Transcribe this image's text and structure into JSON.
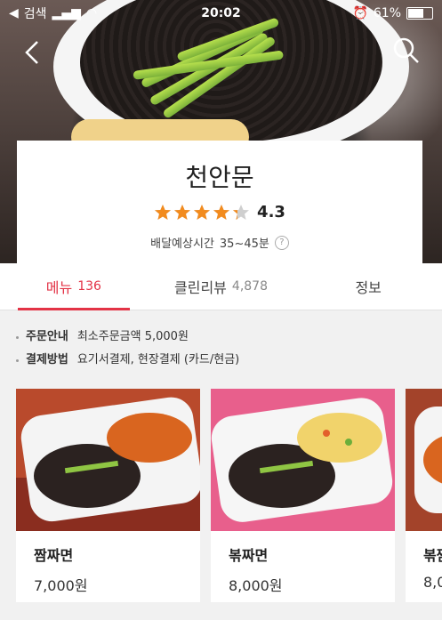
{
  "status_bar": {
    "back_app": "검색",
    "time": "20:02",
    "battery": "61%"
  },
  "header": {
    "icons": [
      "back-arrow-icon",
      "search-icon"
    ]
  },
  "restaurant": {
    "name": "천안문",
    "rating": "4.3",
    "stars": 4.3,
    "delivery_label": "배달예상시간",
    "delivery_time": "35~45분"
  },
  "tabs": [
    {
      "label": "메뉴",
      "count": "136",
      "active": true
    },
    {
      "label": "클린리뷰",
      "count": "4,878",
      "active": false
    },
    {
      "label": "정보",
      "count": "",
      "active": false
    }
  ],
  "info": [
    {
      "label": "주문안내",
      "value": "최소주문금액 5,000원"
    },
    {
      "label": "결제방법",
      "value": "요기서결제, 현장결제 (카드/현금)"
    }
  ],
  "menu": [
    {
      "name": "짬짜면",
      "price": "7,000원"
    },
    {
      "name": "볶짜면",
      "price": "8,000원"
    },
    {
      "name": "볶짬",
      "price": "8,0"
    }
  ],
  "colors": {
    "accent": "#e33346",
    "star": "#f28b1e"
  }
}
